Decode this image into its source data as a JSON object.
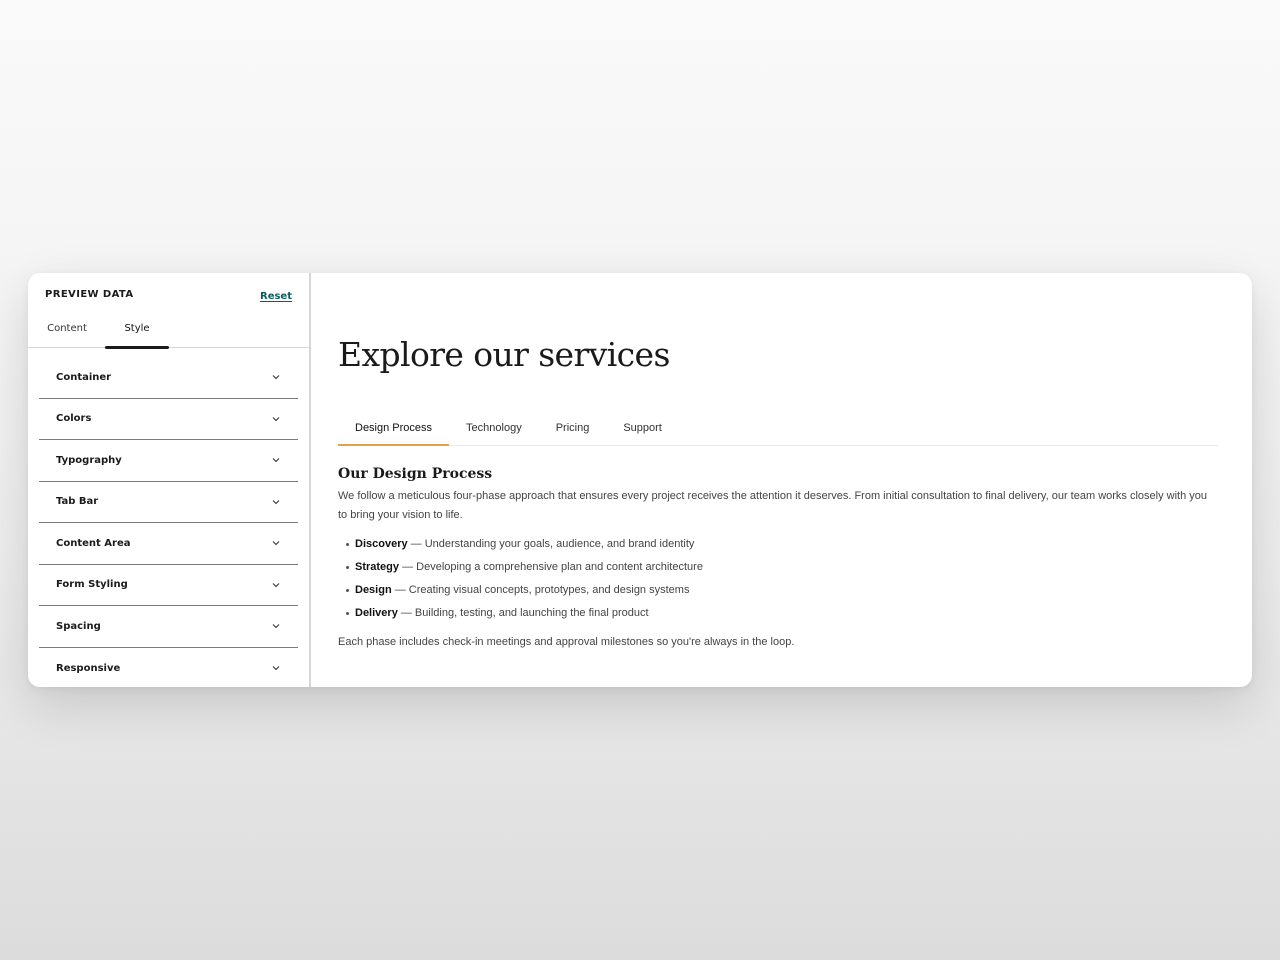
{
  "sidebar": {
    "title": "PREVIEW DATA",
    "reset_label": "Reset",
    "tabs": [
      {
        "label": "Content"
      },
      {
        "label": "Style"
      }
    ],
    "sections": [
      {
        "label": "Container"
      },
      {
        "label": "Colors"
      },
      {
        "label": "Typography"
      },
      {
        "label": "Tab Bar"
      },
      {
        "label": "Content Area"
      },
      {
        "label": "Form Styling"
      },
      {
        "label": "Spacing"
      },
      {
        "label": "Responsive"
      }
    ],
    "chevron_icon": "chevron-down-icon"
  },
  "main": {
    "title": "Explore our services",
    "tabs": [
      {
        "label": "Design Process"
      },
      {
        "label": "Technology"
      },
      {
        "label": "Pricing"
      },
      {
        "label": "Support"
      }
    ],
    "active_tab": "Design Process",
    "panel": {
      "heading": "Our Design Process",
      "intro": "We follow a meticulous four-phase approach that ensures every project receives the attention it deserves. From initial consultation to final delivery, our team works closely with you to bring your vision to life.",
      "phases": [
        {
          "name": "Discovery",
          "desc": " — Understanding your goals, audience, and brand identity"
        },
        {
          "name": "Strategy",
          "desc": " — Developing a comprehensive plan and content architecture"
        },
        {
          "name": "Design",
          "desc": " — Creating visual concepts, prototypes, and design systems"
        },
        {
          "name": "Delivery",
          "desc": " — Building, testing, and launching the final product"
        }
      ],
      "footer": "Each phase includes check-in meetings and approval milestones so you're always in the loop."
    }
  },
  "colors": {
    "accent_tab_underline": "#e4a14b",
    "reset_link": "#0e5d5d",
    "text_dark": "#1a1a1a"
  }
}
